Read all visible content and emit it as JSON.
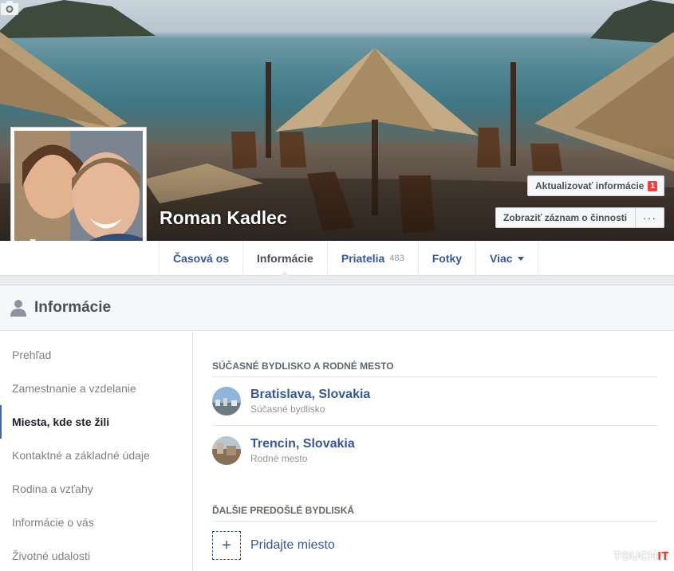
{
  "profile": {
    "name": "Roman Kadlec"
  },
  "cover_buttons": {
    "update_info_label": "Aktualizovať informácie",
    "update_info_badge": "1",
    "activity_log_label": "Zobraziť záznam o činnosti",
    "more_label": "···"
  },
  "nav": {
    "tabs": [
      {
        "label": "Časová os"
      },
      {
        "label": "Informácie",
        "active": true
      },
      {
        "label": "Priatelia",
        "count": "483"
      },
      {
        "label": "Fotky"
      },
      {
        "label": "Viac"
      }
    ]
  },
  "about": {
    "title": "Informácie",
    "sidebar": [
      {
        "label": "Prehľad"
      },
      {
        "label": "Zamestnanie a vzdelanie"
      },
      {
        "label": "Miesta, kde ste žili",
        "active": true
      },
      {
        "label": "Kontaktné a základné údaje"
      },
      {
        "label": "Rodina a vzťahy"
      },
      {
        "label": "Informácie o vás"
      },
      {
        "label": "Životné udalosti"
      }
    ],
    "current_section_heading": "Súčasné bydlisko a rodné mesto",
    "places": [
      {
        "name": "Bratislava, Slovakia",
        "sub": "Súčasné bydlisko"
      },
      {
        "name": "Trencin, Slovakia",
        "sub": "Rodné mesto"
      }
    ],
    "other_section_heading": "ĎALŠIE PREDOŠLÉ BYDLISKÁ",
    "add_place_label": "Pridajte miesto"
  },
  "watermark": {
    "prefix": "TOUCH",
    "suffix": "IT"
  },
  "colors": {
    "link": "#365899",
    "badge": "#fa3e3e",
    "active_indicator": "#4267b2"
  },
  "icons": {
    "cover_camera": "camera-icon",
    "profile_camera": "camera-icon",
    "section": "person-icon",
    "dropdown": "caret-down-icon",
    "add": "plus-icon"
  }
}
